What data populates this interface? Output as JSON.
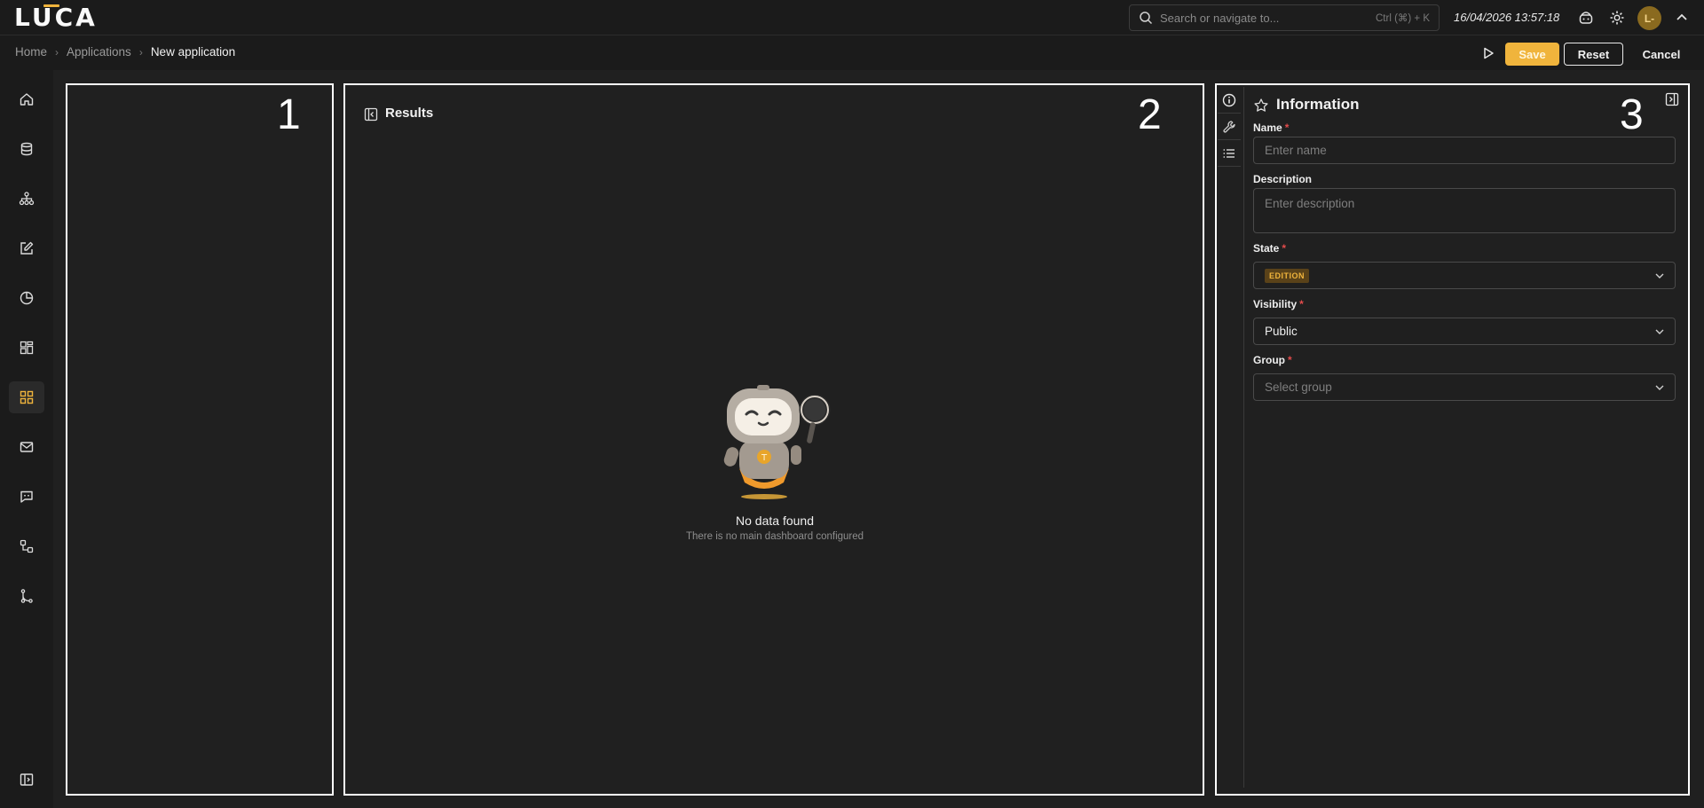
{
  "app": {
    "logo": "LUCA"
  },
  "topbar": {
    "search_placeholder": "Search or navigate to...",
    "search_shortcut": "Ctrl (⌘) + K",
    "datetime": "16/04/2026 13:57:18",
    "avatar_initials": "L-",
    "icons": [
      "support-icon",
      "gear-icon",
      "chevron-up-icon"
    ]
  },
  "breadcrumb": {
    "items": [
      "Home",
      "Applications"
    ],
    "current": "New application"
  },
  "actions": {
    "save": "Save",
    "reset": "Reset",
    "cancel": "Cancel"
  },
  "sidenav": {
    "items": [
      "home",
      "database",
      "hierarchy",
      "edit",
      "pie-chart",
      "dashboard-layout",
      "applications",
      "mail",
      "chat",
      "workflow",
      "git-branch"
    ],
    "active": "applications",
    "footer_icon": "sidebar-toggle"
  },
  "panels": {
    "left": {
      "number": "1"
    },
    "center": {
      "number": "2",
      "title": "Results",
      "empty_title": "No data found",
      "empty_subtitle": "There is no main dashboard configured"
    },
    "right": {
      "number": "3",
      "title": "Information",
      "tabs": [
        "info-icon",
        "wrench-icon",
        "list-icon"
      ],
      "fields": {
        "name": {
          "label": "Name",
          "placeholder": "Enter name",
          "required": true
        },
        "description": {
          "label": "Description",
          "placeholder": "Enter description",
          "required": false
        },
        "state": {
          "label": "State",
          "value": "EDITION",
          "required": true
        },
        "visibility": {
          "label": "Visibility",
          "value": "Public",
          "required": true
        },
        "group": {
          "label": "Group",
          "placeholder": "Select group",
          "required": true
        }
      }
    }
  },
  "colors": {
    "accent": "#f0b43c",
    "background": "#202020",
    "required": "#e24b4b"
  }
}
